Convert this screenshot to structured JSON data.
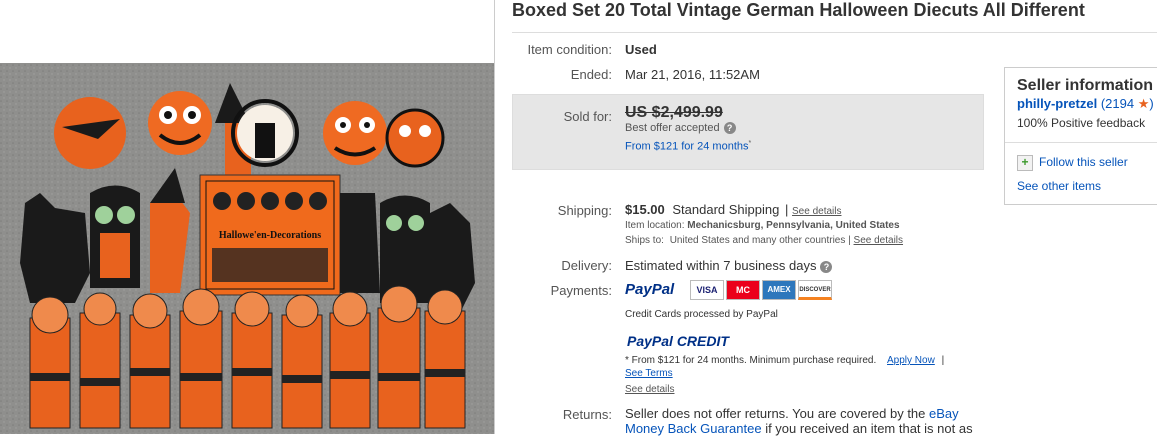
{
  "title": "Boxed Set 20 Total Vintage German Halloween Diecuts All Different",
  "photo": {
    "box_label": "Hallowe'en-Decorations"
  },
  "condition": {
    "label": "Item condition:",
    "value": "Used"
  },
  "ended": {
    "label": "Ended:",
    "date": "Mar 21, 2016",
    "time": ", 11:52AM"
  },
  "sold": {
    "label": "Sold for:",
    "price": "US $2,499.99",
    "offer": "Best offer accepted",
    "financing": "From $121 for 24 months",
    "asterisk": "*"
  },
  "shipping": {
    "label": "Shipping:",
    "cost": "$15.00",
    "method": "Standard Shipping",
    "separator": "|",
    "details_link": "See details",
    "location_label": "Item location:",
    "location": "Mechanicsburg, Pennsylvania, United States",
    "ships_to_label": "Ships to:",
    "ships_to": "United States and many other countries",
    "ships_to_link": "See details"
  },
  "delivery": {
    "label": "Delivery:",
    "value": "Estimated within 7 business days"
  },
  "payments": {
    "label": "Payments:",
    "paypal": "PayPal",
    "cards": [
      "VISA",
      "MC",
      "AMEX",
      "DISCOVER"
    ],
    "cards_note": "Credit Cards processed by PayPal",
    "credit_logo": "PayPal CREDIT",
    "credit_note": "* From $121 for 24 months. Minimum purchase required.",
    "apply_now": "Apply Now",
    "separator": "|",
    "see_terms": "See Terms",
    "see_details": "See details"
  },
  "returns": {
    "label": "Returns:",
    "text1": "Seller does not offer returns. You are covered by the ",
    "link1": "eBay",
    "link2": "Money Back Guarantee",
    "text2": " if you received an item that is not as"
  },
  "seller": {
    "heading": "Seller information",
    "name": "philly-pretzel",
    "score": "(2194",
    "score_close": ")",
    "feedback": "100% Positive feedback",
    "follow": "Follow this seller",
    "other_items": "See other items"
  },
  "colors": {
    "link": "#0654ba",
    "accent": "#e8621e",
    "paypal_blue": "#003087",
    "paypal_light": "#009cde"
  }
}
